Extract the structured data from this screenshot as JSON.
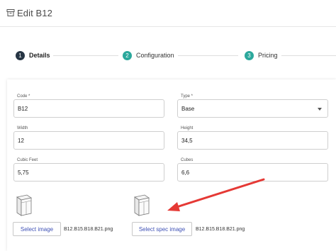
{
  "header": {
    "title": "Edit B12",
    "icon": "box-icon"
  },
  "stepper": {
    "steps": [
      {
        "number": "1",
        "label": "Details",
        "active": true
      },
      {
        "number": "2",
        "label": "Configuration",
        "active": false
      },
      {
        "number": "3",
        "label": "Pricing",
        "active": false
      }
    ]
  },
  "form": {
    "code": {
      "label": "Code *",
      "value": "B12"
    },
    "type": {
      "label": "Type *",
      "value": "Base"
    },
    "width": {
      "label": "Width",
      "value": "12"
    },
    "height": {
      "label": "Height",
      "value": "34,5"
    },
    "cubic_feet": {
      "label": "Cubic Feet",
      "value": "5,75"
    },
    "cubes": {
      "label": "Cubes",
      "value": "6,6"
    }
  },
  "images": {
    "image": {
      "button_label": "Select image",
      "filename": "B12.B15.B18.B21.png"
    },
    "spec_image": {
      "button_label": "Select spec image",
      "filename": "B12.B15.B18.B21.png"
    }
  },
  "colors": {
    "accent": "#3f51b5",
    "step_active": "#263544",
    "step_inactive": "#2ba89c",
    "annotation_arrow": "#e53935"
  }
}
